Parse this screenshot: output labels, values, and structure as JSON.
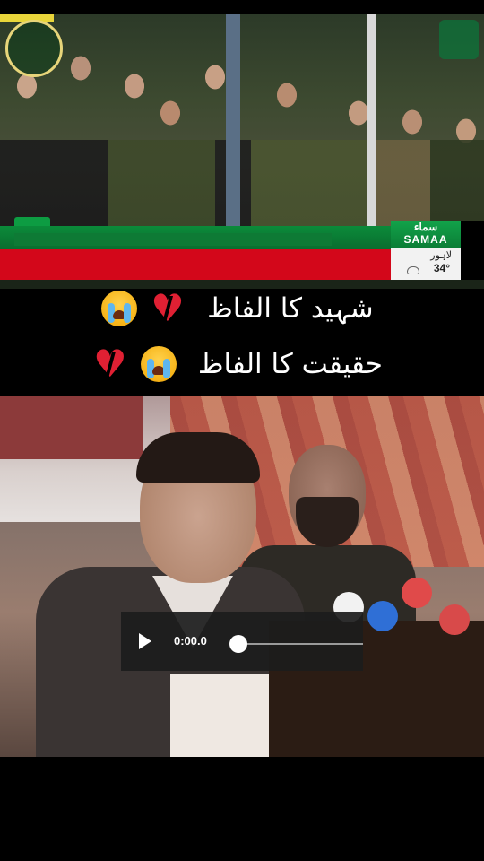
{
  "tv_clip": {
    "channel_name_urdu": "سماء",
    "channel_name": "SAMAA",
    "city": "لاہور",
    "temperature": "34°"
  },
  "captions": {
    "line1": "شہید کا الفاظ",
    "line2": "حقیقت کا الفاظ"
  },
  "icons": {
    "emoji_crying": "loudly-crying-face-icon",
    "emoji_broken_heart": "broken-heart-icon",
    "play": "play-icon",
    "weather": "cloud-icon"
  },
  "colors": {
    "background": "#000000",
    "ticker_green": "#0b8b3a",
    "ticker_red": "#d3071a",
    "samaa_green": "#12a34a",
    "player_bg": "#1c1c1c"
  },
  "player": {
    "time": "0:00.0",
    "progress": 0
  }
}
